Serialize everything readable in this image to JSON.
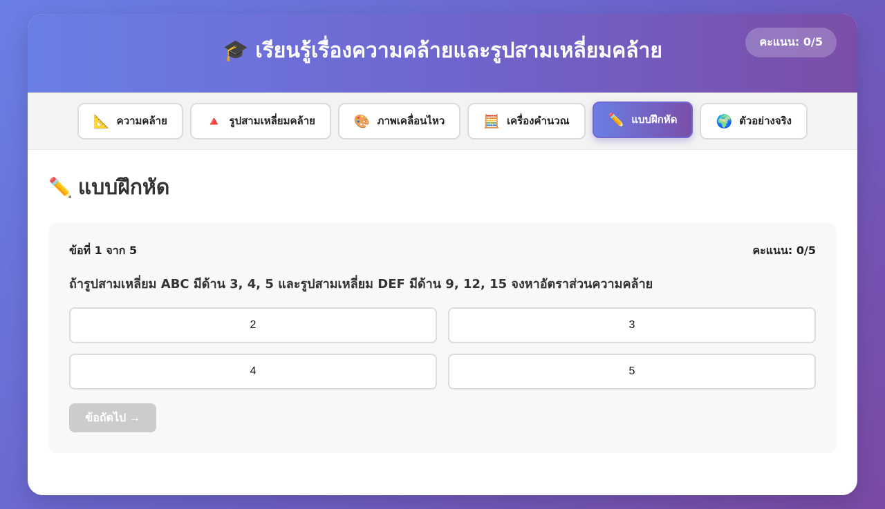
{
  "header": {
    "title_icon": "🎓",
    "title": "เรียนรู้เรื่องความคล้ายและรูปสามเหลี่ยมคล้าย",
    "score": "คะแนน: 0/5"
  },
  "tabs": [
    {
      "icon": "📐",
      "label": "ความคล้าย"
    },
    {
      "icon": "🔺",
      "label": "รูปสามเหลี่ยมคล้าย"
    },
    {
      "icon": "🎨",
      "label": "ภาพเคลื่อนไหว"
    },
    {
      "icon": "🧮",
      "label": "เครื่องคำนวณ"
    },
    {
      "icon": "✏️",
      "label": "แบบฝึกหัด",
      "active": true
    },
    {
      "icon": "🌍",
      "label": "ตัวอย่างจริง"
    }
  ],
  "section": {
    "icon": "✏️",
    "title": "แบบฝึกหัด"
  },
  "quiz": {
    "progress": "ข้อที่ 1 จาก 5",
    "score": "คะแนน: 0/5",
    "question": "ถ้ารูปสามเหลี่ยม ABC มีด้าน 3, 4, 5 และรูปสามเหลี่ยม DEF มีด้าน 9, 12, 15 จงหาอัตราส่วนความคล้าย",
    "options": [
      "2",
      "3",
      "4",
      "5"
    ],
    "next_label": "ข้อถัดไป →"
  },
  "colors": {
    "accent_start": "#6a7fe6",
    "accent_end": "#7a4ea8",
    "disabled_button": "#cccccc"
  }
}
